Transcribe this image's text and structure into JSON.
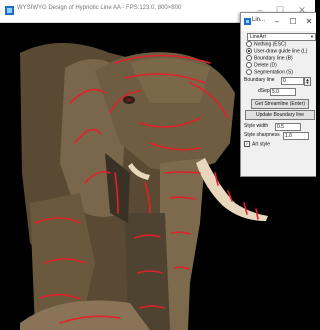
{
  "main_window": {
    "title": "WYSIWYG Design of Hypnotic Line AA - FPS:123.0, 800×800",
    "minimize_glyph": "–",
    "maximize_glyph": "☐",
    "close_glyph": "✕",
    "icon": "app-icon"
  },
  "panel": {
    "title": "Lin...",
    "minimize_glyph": "–",
    "maximize_glyph": "☐",
    "close_glyph": "✕",
    "icon": "app-icon",
    "mode_select": {
      "value": "LineArt",
      "options_visible": [
        "LineArt"
      ]
    },
    "radio_options": [
      {
        "label": "Nothing (ESC)",
        "selected": false
      },
      {
        "label": "User-draw guide line (L)",
        "selected": true
      },
      {
        "label": "Boundary line (B)",
        "selected": false
      },
      {
        "label": "Delete (D)",
        "selected": false
      },
      {
        "label": "Segmentation (S)",
        "selected": false
      }
    ],
    "boundary_line_label": "Boundary line",
    "boundary_line_value": "0",
    "dsep_label": "dSep:",
    "dsep_value": "5.0",
    "get_streamline_button": "Get Streamline (Enter)",
    "update_boundary_button": "Update Boundary line",
    "style_width_label": "Style width",
    "style_width_value": "0.5",
    "style_sharpness_label": "Style sharpness",
    "style_sharpness_value": "1.0",
    "art_style_label": "Art style",
    "art_style_checked": true
  },
  "colors": {
    "background": "#000000",
    "guide_line": "#e0202a",
    "elephant_dark": "#4a3f2c",
    "elephant_mid": "#6b5a40",
    "elephant_light": "#8b7556",
    "tusk": "#e8d6bd"
  }
}
